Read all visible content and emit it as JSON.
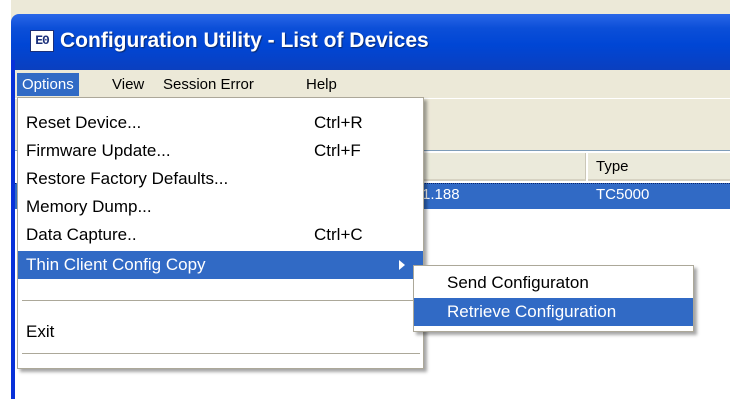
{
  "window": {
    "title": "Configuration Utility - List of Devices",
    "icon_text": "E0"
  },
  "menubar": {
    "items": [
      {
        "label": "Options"
      },
      {
        "label": "View"
      },
      {
        "label": "Session Error"
      },
      {
        "label": "Help"
      }
    ]
  },
  "options_menu": {
    "items": [
      {
        "label": "Reset Device...",
        "shortcut": "Ctrl+R"
      },
      {
        "label": "Firmware Update...",
        "shortcut": "Ctrl+F"
      },
      {
        "label": "Restore Factory Defaults...",
        "shortcut": ""
      },
      {
        "label": "Memory Dump...",
        "shortcut": ""
      },
      {
        "label": "Data Capture..",
        "shortcut": "Ctrl+C"
      },
      {
        "label": "Thin Client Config Copy",
        "shortcut": ""
      },
      {
        "label": "Exit",
        "shortcut": ""
      }
    ]
  },
  "submenu": {
    "items": [
      {
        "label": "Send Configuraton"
      },
      {
        "label": "Retrieve Configuration"
      }
    ]
  },
  "device_list": {
    "columns": [
      "ess",
      "Type"
    ],
    "rows": [
      {
        "address": "1.188",
        "type": "TC5000"
      }
    ]
  },
  "colors": {
    "titlebar": "#0046d5",
    "highlight": "#316ac5",
    "menu_face": "#ece9d8"
  },
  "icons": {
    "submenu_arrow": "triangle-right"
  }
}
